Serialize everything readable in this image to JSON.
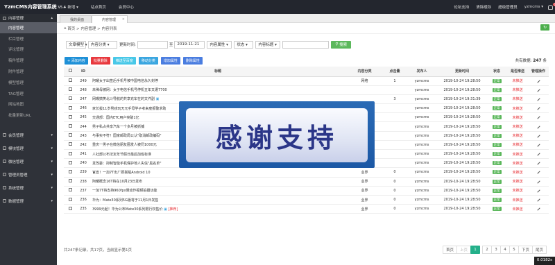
{
  "topbar": {
    "logo": "YzmCMS内容管理系统",
    "version": "V5.4",
    "nav": [
      "+ 新增 ▾",
      "站点首页",
      "会员中心"
    ],
    "right": [
      "论坛支持",
      "清除缓存",
      "超级管理员",
      "yzmcms ▾"
    ],
    "badge": "0"
  },
  "sidebar": [
    {
      "group": "内容管理",
      "open": true,
      "items": [
        "内容管理",
        "栏目管理",
        "评论管理",
        "稿件管理",
        "附件管理",
        "模型管理",
        "TAG管理",
        "网站地图",
        "批量更新URL"
      ],
      "active": 0
    },
    {
      "group": "会员管理",
      "open": false,
      "items": []
    },
    {
      "group": "模块管理",
      "open": false,
      "items": []
    },
    {
      "group": "微信管理",
      "open": false,
      "items": []
    },
    {
      "group": "管理员管理",
      "open": false,
      "items": []
    },
    {
      "group": "系统管理",
      "open": false,
      "items": []
    },
    {
      "group": "数据管理",
      "open": false,
      "items": []
    }
  ],
  "tabs": [
    "我的桌面",
    "内容管理"
  ],
  "breadcrumb": "首页 > 内容管理 > 内容列表",
  "filter": {
    "search_type": "文章模型 ▾",
    "category": "内容分类 ▾",
    "time_label": "更新时间:",
    "to": "至",
    "end_date": "2019-11-21",
    "attr": "内容属性 ▾",
    "status": "状态 ▾",
    "title_field": "内容标题 ▾",
    "search_btn": "搜索"
  },
  "total": {
    "label": "共有数据:",
    "count": "247",
    "unit": "条"
  },
  "actions": [
    "+ 添加内容",
    "批量删除",
    "推送至百度",
    "移动分类",
    "增加属性",
    "删除属性"
  ],
  "table": {
    "headers": [
      "",
      "ID",
      "标题",
      "内容分类",
      "点击量",
      "发布人",
      "更新时间",
      "状态",
      "是否推送",
      "管理操作"
    ],
    "rows": [
      {
        "id": "249",
        "title": "阿耀女子出签后手机号被中国电信永久封停",
        "cat": "网络",
        "hits": "1",
        "user": "yzmcms",
        "time": "2019-10-24 19:28:50"
      },
      {
        "id": "248",
        "title": "未稀母被网：女子电信手机号停机五年又遭7700",
        "cat": "",
        "hits": "",
        "user": "yzmcms",
        "time": "2019-10-24 19:28:50"
      },
      {
        "id": "247",
        "title": "网曝搞笑北斗导航的共享充车在的文件副",
        "cat": "",
        "hits": "3",
        "user": "yzmcms",
        "time": "2019-10-24 19:31:39",
        "pic": true
      },
      {
        "id": "246",
        "title": "家长拔11岁男孩玩无元手母学子考来度报警求助",
        "cat": "",
        "hits": "",
        "user": "yzmcms",
        "time": "2019-10-24 19:28:50"
      },
      {
        "id": "245",
        "title": "交通部：国内ETC用户突破1亿",
        "cat": "",
        "hits": "",
        "user": "yzmcms",
        "time": "2019-10-24 19:28:50"
      },
      {
        "id": "244",
        "title": "男子私占共享汽车一个多月被抓捕",
        "cat": "",
        "hits": "",
        "user": "yzmcms",
        "time": "2019-10-24 19:28:50"
      },
      {
        "id": "243",
        "title": "与事实不符！国家邮政局公认\"取消邮政编码\"",
        "cat": "",
        "hits": "",
        "user": "yzmcms",
        "time": "2019-10-24 19:28:50"
      },
      {
        "id": "242",
        "title": "重庆一男子在微信朋友圈发人被罚1000元",
        "cat": "",
        "hits": "",
        "user": "yzmcms",
        "time": "2019-10-24 19:28:50"
      },
      {
        "id": "241",
        "title": "人社部公布法定年节假日最后加班标准",
        "cat": "",
        "hits": "",
        "user": "yzmcms",
        "time": "2019-10-24 19:28:50"
      },
      {
        "id": "240",
        "title": "发改委：抑制智能手机保护地人失信\"黑名单\"",
        "cat": "网络",
        "hits": "",
        "user": "yzmcms",
        "time": "2019-10-24 19:28:50"
      },
      {
        "id": "239",
        "title": "官宣！一加7T出厂即搭载Android 10",
        "cat": "业界",
        "hits": "0",
        "user": "yzmcms",
        "time": "2019-10-24 19:28:50"
      },
      {
        "id": "238",
        "title": "阿耀概念16T将在10月23日发布",
        "cat": "业界",
        "hits": "0",
        "user": "yzmcms",
        "time": "2019-10-24 19:28:50"
      },
      {
        "id": "237",
        "title": "一加7T将支持960fps慢动作视频拍摄功能",
        "cat": "业界",
        "hits": "0",
        "user": "yzmcms",
        "time": "2019-10-24 19:28:50"
      },
      {
        "id": "236",
        "title": "华为：Mate30系列5G版将于11月1日发售",
        "cat": "业界",
        "hits": "0",
        "user": "yzmcms",
        "time": "2019-10-24 19:28:50"
      },
      {
        "id": "235",
        "title": "3999元起！华为公布Mate30系列限行权售价",
        "cat": "业界",
        "hits": "0",
        "user": "yzmcms",
        "time": "2019-10-24 19:28:50",
        "pic": true,
        "top": true
      }
    ],
    "status_label": "正常",
    "push_label": "未推送"
  },
  "footer": "共247条记录，共17页，当前显示第1页",
  "pager": [
    "首页",
    "上页",
    "1",
    "2",
    "3",
    "4",
    "5",
    "下页",
    "尾页"
  ],
  "pager_active": "1",
  "timer": "0.0182s",
  "overlay_text": "感谢支持"
}
